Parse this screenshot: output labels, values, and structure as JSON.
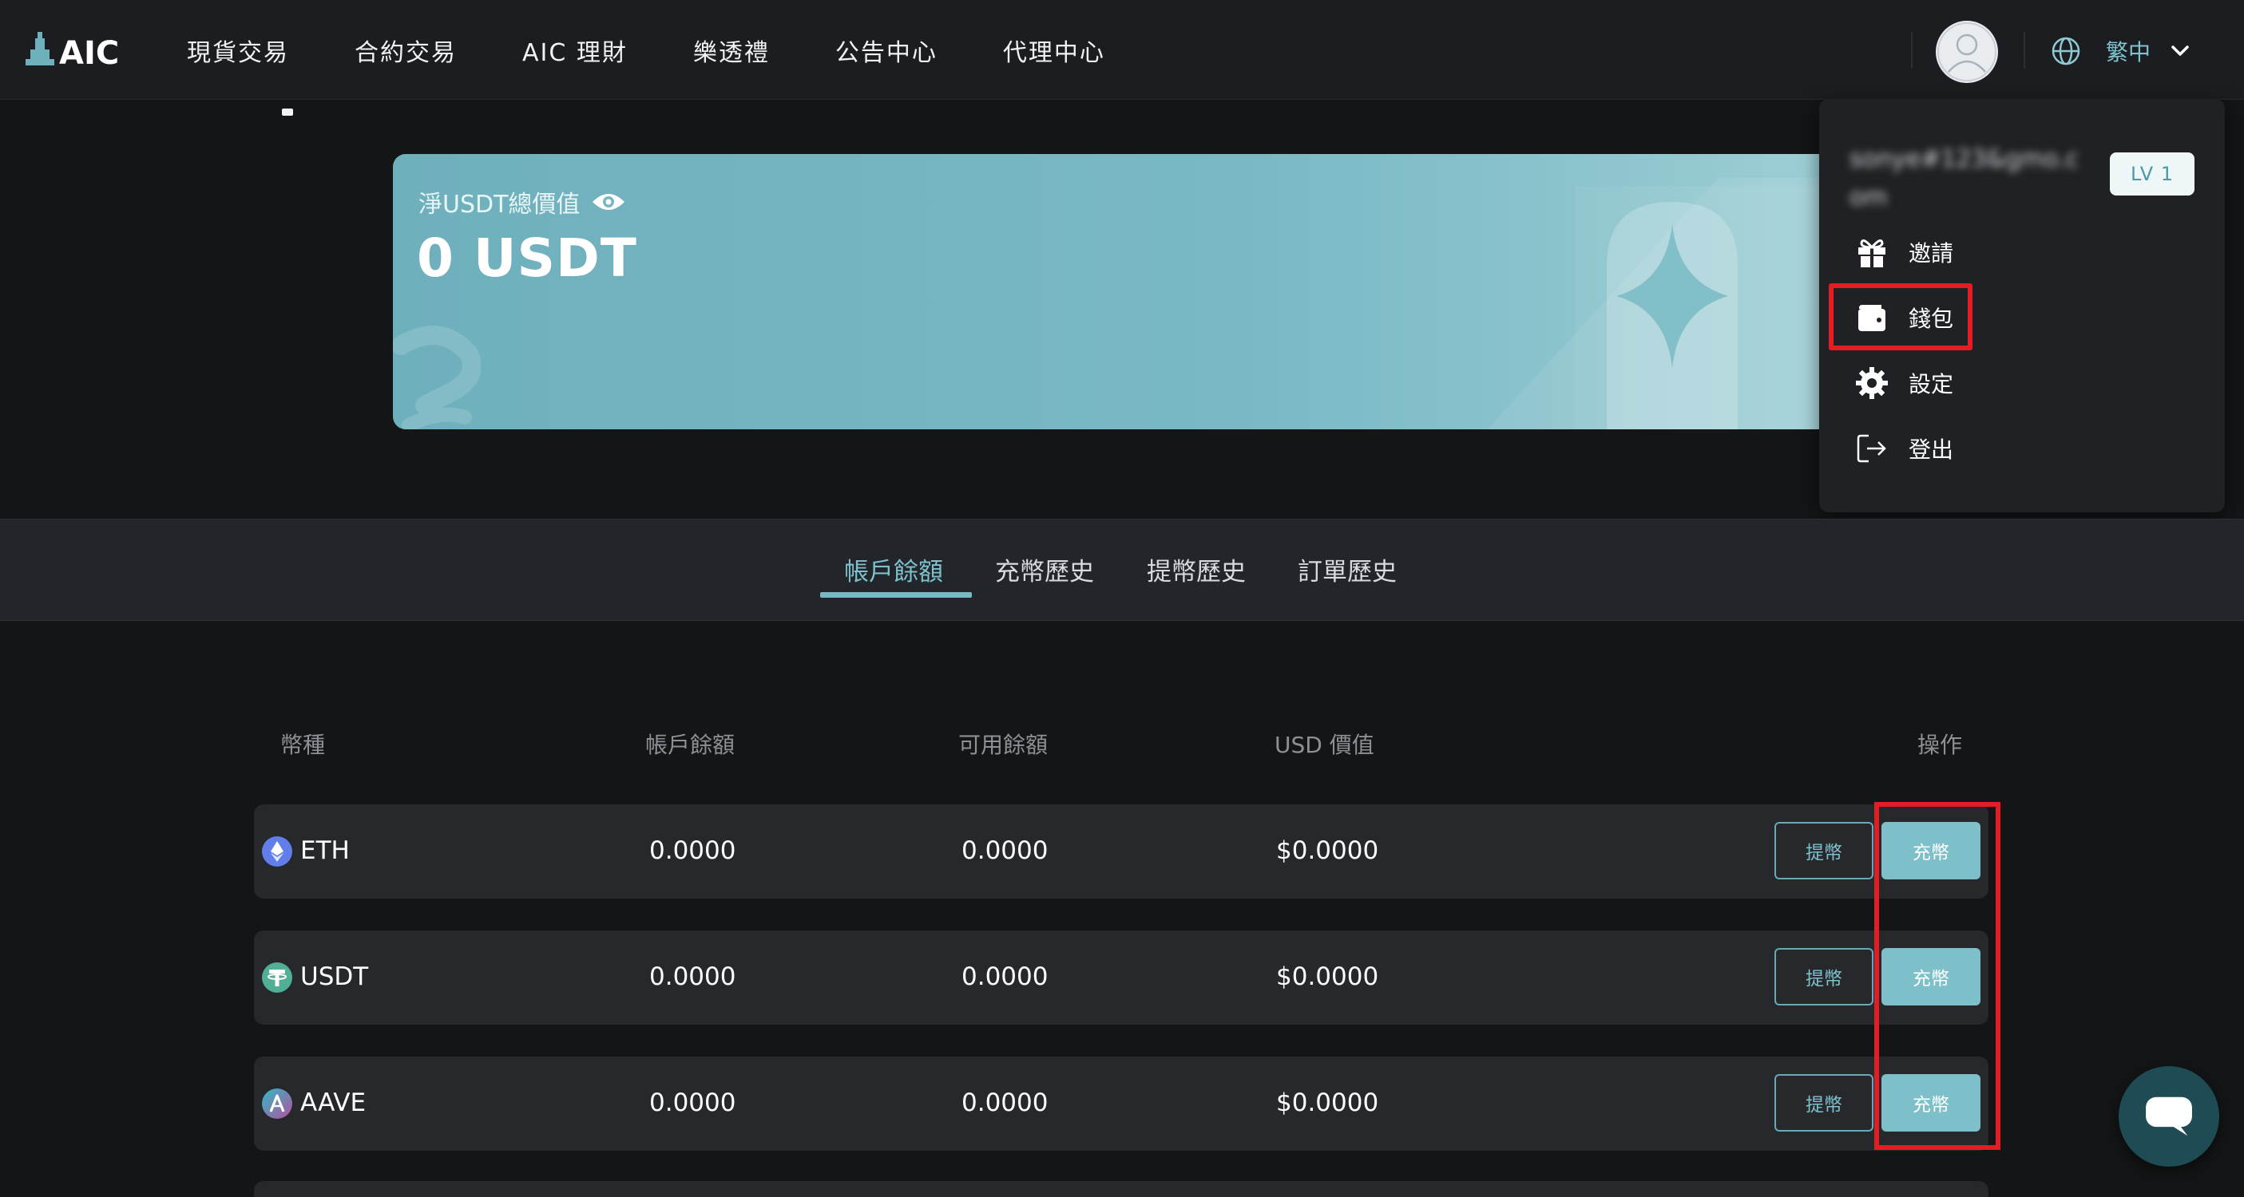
{
  "logo_text": "AIC",
  "nav": {
    "links": [
      "現貨交易",
      "合約交易",
      "AIC 理財",
      "樂透禮",
      "公告中心",
      "代理中心"
    ],
    "language": "繁中"
  },
  "hero": {
    "label": "淨USDT總價值",
    "value": "0 USDT"
  },
  "account_menu": {
    "email": "sonye#123&gmo.com",
    "level": "LV 1",
    "items": [
      {
        "label": "邀請",
        "icon": "gift-icon"
      },
      {
        "label": "錢包",
        "icon": "wallet-icon"
      },
      {
        "label": "設定",
        "icon": "gear-icon"
      },
      {
        "label": "登出",
        "icon": "logout-icon"
      }
    ]
  },
  "tabs": [
    "帳戶餘額",
    "充幣歷史",
    "提幣歷史",
    "訂單歷史"
  ],
  "active_tab": "帳戶餘額",
  "table": {
    "headers": [
      "幣種",
      "帳戶餘額",
      "可用餘額",
      "USD 價值",
      "操作"
    ],
    "rows": [
      {
        "coin": "ETH",
        "balance": "0.0000",
        "available": "0.0000",
        "usd": "$0.0000",
        "withdraw": "提幣",
        "deposit": "充幣",
        "icon_color": "#627eea"
      },
      {
        "coin": "USDT",
        "balance": "0.0000",
        "available": "0.0000",
        "usd": "$0.0000",
        "withdraw": "提幣",
        "deposit": "充幣",
        "icon_color": "#50af95"
      },
      {
        "coin": "AAVE",
        "balance": "0.0000",
        "available": "0.0000",
        "usd": "$0.0000",
        "withdraw": "提幣",
        "deposit": "充幣",
        "icon_color": "#b6509e"
      }
    ]
  },
  "colors": {
    "accent": "#7ec1cc",
    "highlight": "#e41c24",
    "background": "#141516"
  }
}
